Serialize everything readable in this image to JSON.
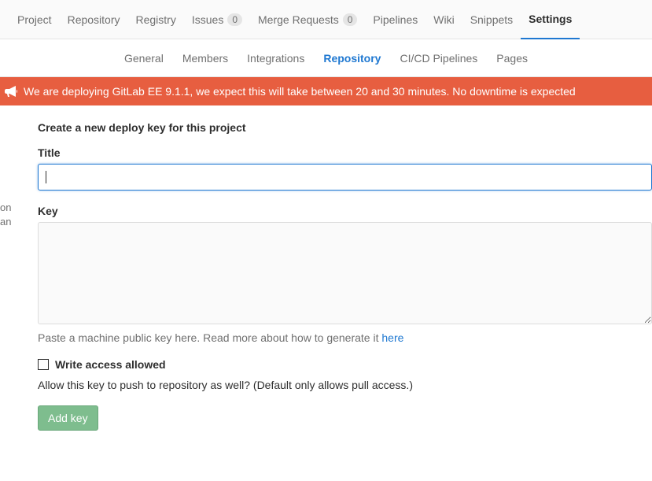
{
  "topnav": {
    "project": "Project",
    "repository": "Repository",
    "registry": "Registry",
    "issues": "Issues",
    "issues_count": "0",
    "merge_requests": "Merge Requests",
    "merge_requests_count": "0",
    "pipelines": "Pipelines",
    "wiki": "Wiki",
    "snippets": "Snippets",
    "settings": "Settings"
  },
  "subnav": {
    "general": "General",
    "members": "Members",
    "integrations": "Integrations",
    "repository": "Repository",
    "cicd": "CI/CD Pipelines",
    "pages": "Pages"
  },
  "broadcast": {
    "message": "We are deploying GitLab EE 9.1.1, we expect this will take between 20 and 30 minutes. No downtime is expected"
  },
  "side": {
    "line1": "on",
    "line2": "an"
  },
  "form": {
    "heading": "Create a new deploy key for this project",
    "title_label": "Title",
    "title_value": "",
    "key_label": "Key",
    "key_value": "",
    "key_help_prefix": "Paste a machine public key here. Read more about how to generate it ",
    "key_help_link": "here",
    "write_access_label": "Write access allowed",
    "write_access_help": "Allow this key to push to repository as well? (Default only allows pull access.)",
    "submit": "Add key"
  }
}
